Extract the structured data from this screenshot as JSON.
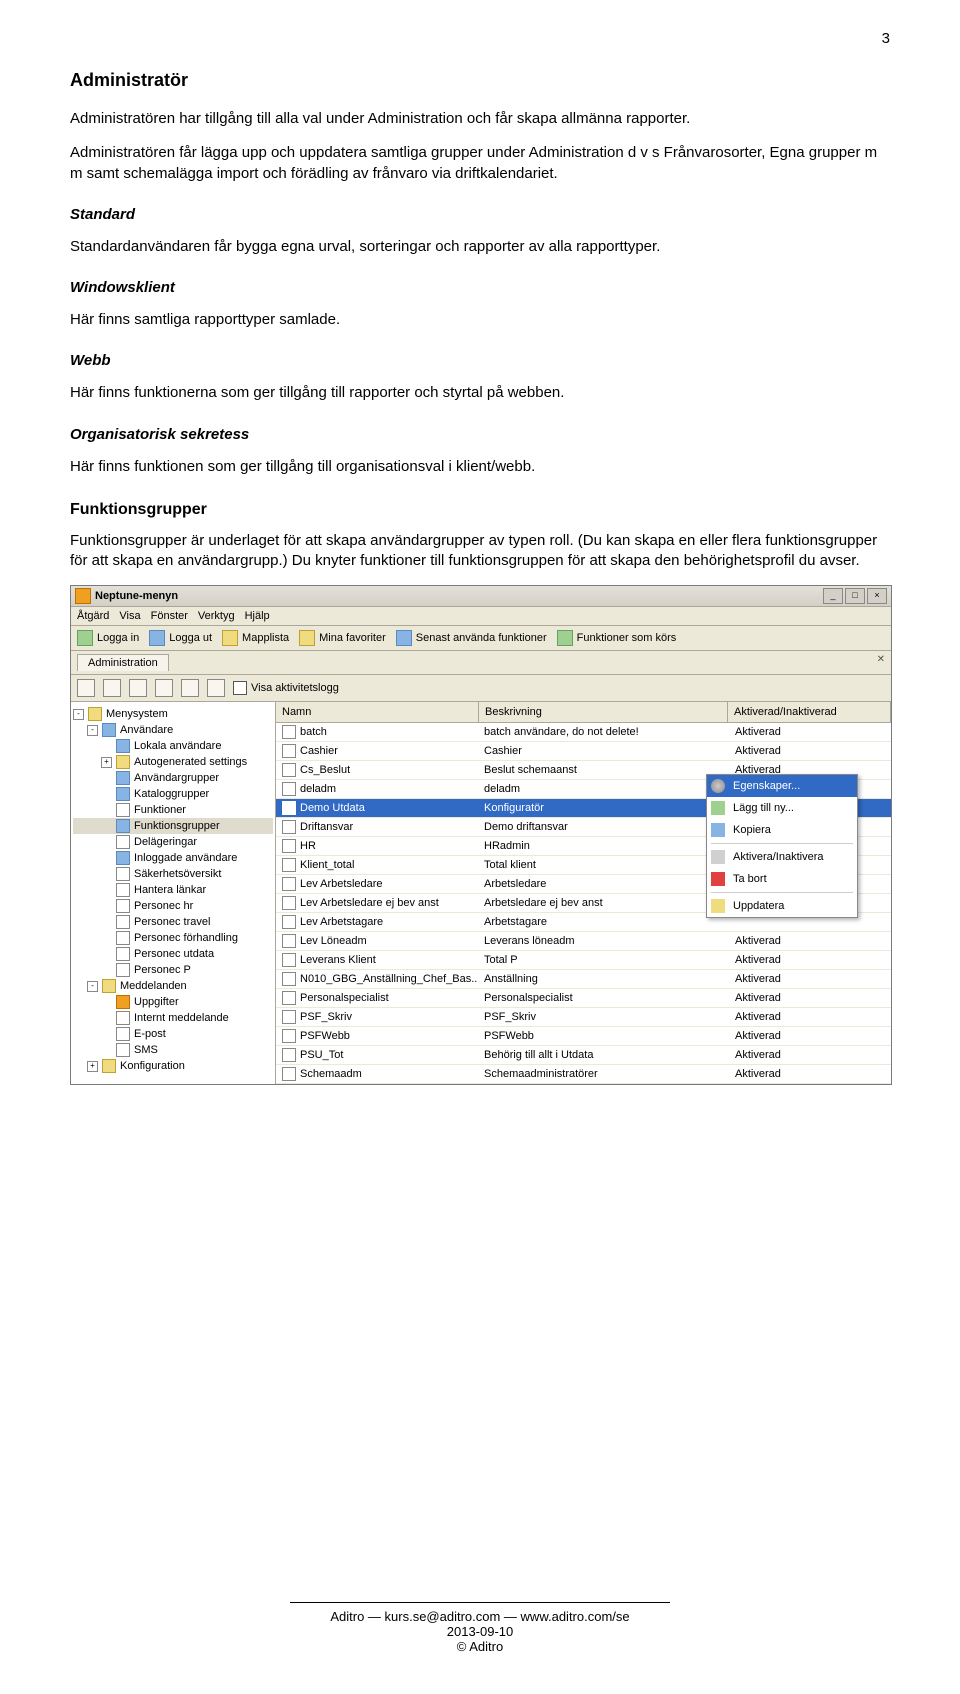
{
  "page_number": "3",
  "sections": {
    "admin_title": "Administratör",
    "admin_p1": "Administratören har tillgång till alla val under Administration och får skapa allmänna rapporter.",
    "admin_p2": "Administratören får lägga upp och uppdatera samtliga grupper under Administration d v s Frånvarosorter, Egna grupper m m samt schemalägga import och förädling av frånvaro via driftkalendariet.",
    "standard_title": "Standard",
    "standard_p": "Standardanvändaren får bygga egna urval, sorteringar och rapporter av alla rapporttyper.",
    "windows_title": "Windowsklient",
    "windows_p": "Här finns samtliga rapporttyper samlade.",
    "webb_title": "Webb",
    "webb_p": "Här finns funktionerna som ger tillgång till rapporter och styrtal på webben.",
    "org_title": "Organisatorisk sekretess",
    "org_p": "Här finns funktionen som ger tillgång till organisationsval i klient/webb.",
    "fg_title": "Funktionsgrupper",
    "fg_p": "Funktionsgrupper är underlaget för att skapa användargrupper av typen roll. (Du kan skapa en eller flera funktionsgrupper för att skapa en användargrupp.) Du knyter funktioner till funktionsgruppen för att skapa den behörighetsprofil du avser."
  },
  "window": {
    "title": "Neptune-menyn",
    "menubar": [
      "Åtgärd",
      "Visa",
      "Fönster",
      "Verktyg",
      "Hjälp"
    ],
    "toolbar": [
      {
        "label": "Logga in"
      },
      {
        "label": "Logga ut"
      },
      {
        "label": "Mapplista"
      },
      {
        "label": "Mina favoriter"
      },
      {
        "label": "Senast använda funktioner"
      },
      {
        "label": "Funktioner som körs"
      }
    ],
    "tab": "Administration",
    "pin_close": "✕",
    "aktivitetslogg": "Visa aktivitetslogg",
    "tree": [
      {
        "ind": 0,
        "exp": "-",
        "icon": "folder",
        "label": "Menysystem"
      },
      {
        "ind": 1,
        "exp": "-",
        "icon": "group",
        "label": "Användare"
      },
      {
        "ind": 2,
        "icon": "group",
        "label": "Lokala användare"
      },
      {
        "ind": 2,
        "exp": "+",
        "icon": "folder",
        "label": "Autogenerated settings"
      },
      {
        "ind": 2,
        "icon": "group",
        "label": "Användargrupper"
      },
      {
        "ind": 2,
        "icon": "group",
        "label": "Kataloggrupper"
      },
      {
        "ind": 2,
        "icon": "doc",
        "label": "Funktioner"
      },
      {
        "ind": 2,
        "icon": "group",
        "label": "Funktionsgrupper",
        "sel": true
      },
      {
        "ind": 2,
        "icon": "doc",
        "label": "Delägeringar"
      },
      {
        "ind": 2,
        "icon": "group",
        "label": "Inloggade användare"
      },
      {
        "ind": 2,
        "icon": "doc",
        "label": "Säkerhetsöversikt"
      },
      {
        "ind": 2,
        "icon": "doc",
        "label": "Hantera länkar"
      },
      {
        "ind": 2,
        "icon": "doc",
        "label": "Personec hr"
      },
      {
        "ind": 2,
        "icon": "doc",
        "label": "Personec travel"
      },
      {
        "ind": 2,
        "icon": "doc",
        "label": "Personec förhandling"
      },
      {
        "ind": 2,
        "icon": "doc",
        "label": "Personec utdata"
      },
      {
        "ind": 2,
        "icon": "doc",
        "label": "Personec P"
      },
      {
        "ind": 1,
        "exp": "-",
        "icon": "folder",
        "label": "Meddelanden"
      },
      {
        "ind": 2,
        "icon": "bell",
        "label": "Uppgifter"
      },
      {
        "ind": 2,
        "icon": "doc",
        "label": "Internt meddelande"
      },
      {
        "ind": 2,
        "icon": "doc",
        "label": "E-post"
      },
      {
        "ind": 2,
        "icon": "doc",
        "label": "SMS"
      },
      {
        "ind": 1,
        "exp": "+",
        "icon": "folder",
        "label": "Konfiguration"
      }
    ],
    "grid_headers": {
      "name": "Namn",
      "desc": "Beskrivning",
      "act": "Aktiverad/Inaktiverad"
    },
    "grid": [
      {
        "name": "batch",
        "desc": "batch användare, do not delete!",
        "act": "Aktiverad"
      },
      {
        "name": "Cashier",
        "desc": "Cashier",
        "act": "Aktiverad"
      },
      {
        "name": "Cs_Beslut",
        "desc": "Beslut schemaanst",
        "act": "Aktiverad"
      },
      {
        "name": "deladm",
        "desc": "deladm",
        "act": ""
      },
      {
        "name": "Demo Utdata",
        "desc": "Konfiguratör",
        "act": "",
        "sel": true
      },
      {
        "name": "Driftansvar",
        "desc": "Demo driftansvar",
        "act": ""
      },
      {
        "name": "HR",
        "desc": "HRadmin",
        "act": ""
      },
      {
        "name": "Klient_total",
        "desc": "Total klient",
        "act": ""
      },
      {
        "name": "Lev Arbetsledare",
        "desc": "Arbetsledare",
        "act": ""
      },
      {
        "name": "Lev Arbetsledare ej bev anst",
        "desc": "Arbetsledare ej bev anst",
        "act": ""
      },
      {
        "name": "Lev Arbetstagare",
        "desc": "Arbetstagare",
        "act": ""
      },
      {
        "name": "Lev Löneadm",
        "desc": "Leverans löneadm",
        "act": "Aktiverad"
      },
      {
        "name": "Leverans Klient",
        "desc": "Total P",
        "act": "Aktiverad"
      },
      {
        "name": "N010_GBG_Anställning_Chef_Bas...",
        "desc": "Anställning",
        "act": "Aktiverad"
      },
      {
        "name": "Personalspecialist",
        "desc": "Personalspecialist",
        "act": "Aktiverad"
      },
      {
        "name": "PSF_Skriv",
        "desc": "PSF_Skriv",
        "act": "Aktiverad"
      },
      {
        "name": "PSFWebb",
        "desc": "PSFWebb",
        "act": "Aktiverad"
      },
      {
        "name": "PSU_Tot",
        "desc": "Behörig till allt i Utdata",
        "act": "Aktiverad"
      },
      {
        "name": "Schemaadm",
        "desc": "Schemaadministratörer",
        "act": "Aktiverad"
      }
    ],
    "context_menu": [
      {
        "icon": "gear",
        "label": "Egenskaper...",
        "sel": true
      },
      {
        "icon": "plus",
        "label": "Lägg till ny..."
      },
      {
        "icon": "copy",
        "label": "Kopiera"
      },
      {
        "sep": true
      },
      {
        "icon": "swap",
        "label": "Aktivera/Inaktivera"
      },
      {
        "icon": "del",
        "label": "Ta bort"
      },
      {
        "sep": true
      },
      {
        "icon": "up",
        "label": "Uppdatera"
      }
    ]
  },
  "footer": {
    "line1": "Aditro — kurs.se@aditro.com — www.aditro.com/se",
    "line2": "2013-09-10",
    "line3": "© Aditro"
  }
}
